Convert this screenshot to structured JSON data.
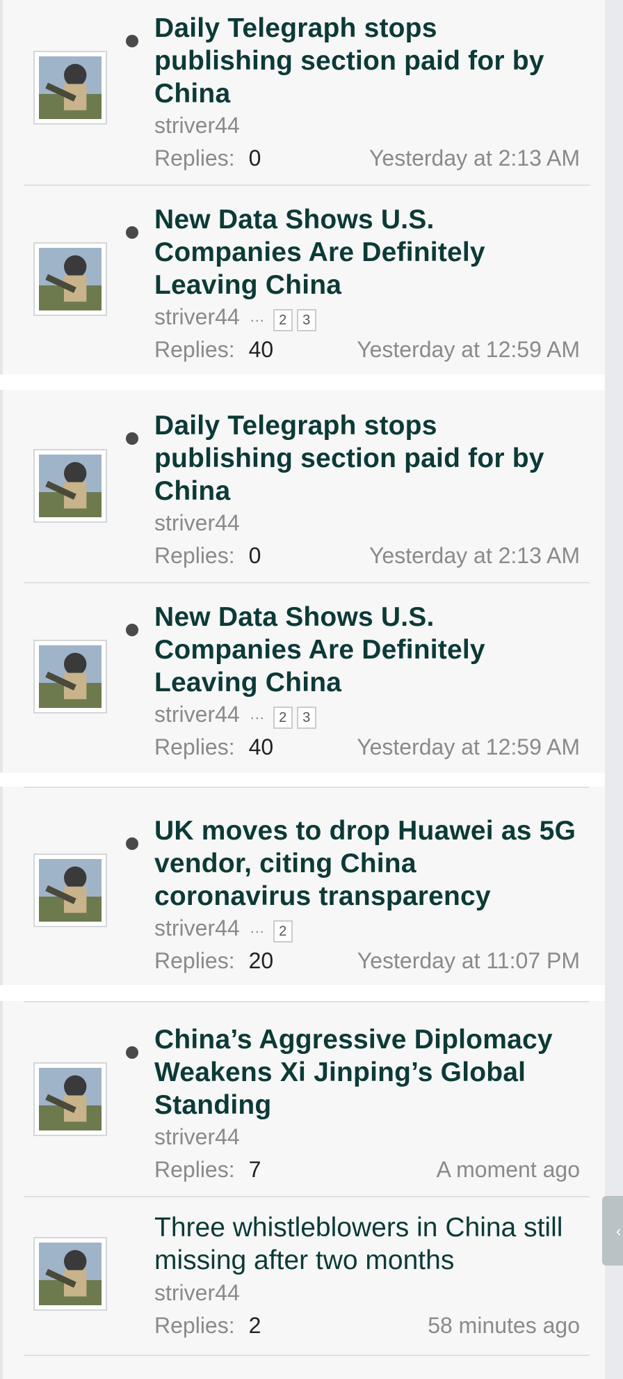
{
  "threads": [
    {
      "title": "Daily Telegraph stops publishing section paid for by China",
      "author": "striver44",
      "pages": [],
      "replies_label": "Replies:",
      "replies": "0",
      "time": "Yesterday at 2:13 AM",
      "unread": true
    },
    {
      "title": "New Data Shows U.S. Companies Are Definitely Leaving China",
      "author": "striver44",
      "pages": [
        "2",
        "3"
      ],
      "replies_label": "Replies:",
      "replies": "40",
      "time": "Yesterday at 12:59 AM",
      "unread": true
    },
    {
      "title": "Daily Telegraph stops publishing section paid for by China",
      "author": "striver44",
      "pages": [],
      "replies_label": "Replies:",
      "replies": "0",
      "time": "Yesterday at 2:13 AM",
      "unread": true
    },
    {
      "title": "New Data Shows U.S. Companies Are Definitely Leaving China",
      "author": "striver44",
      "pages": [
        "2",
        "3"
      ],
      "replies_label": "Replies:",
      "replies": "40",
      "time": "Yesterday at 12:59 AM",
      "unread": true
    },
    {
      "title": "UK moves to drop Huawei as 5G vendor, citing China coronavirus transparency",
      "author": "striver44",
      "pages": [
        "2"
      ],
      "replies_label": "Replies:",
      "replies": "20",
      "time": "Yesterday at 11:07 PM",
      "unread": true
    },
    {
      "title": "China’s Aggressive Diplomacy Weakens Xi Jinping’s Global Standing",
      "author": "striver44",
      "pages": [],
      "replies_label": "Replies:",
      "replies": "7",
      "time": "A moment ago",
      "unread": true
    },
    {
      "title": "Three whistleblowers in China still missing after two months",
      "author": "striver44",
      "pages": [],
      "replies_label": "Replies:",
      "replies": "2",
      "time": "58 minutes ago",
      "unread": false
    }
  ],
  "ellipsis": "…",
  "icons": {
    "avatar": "user-avatar-icon",
    "unread": "unread-dot-icon",
    "side_tab": "chevron-left-icon"
  },
  "colors": {
    "title": "#0c3a36",
    "meta": "#8a8a8a",
    "background": "#f7f7f7"
  }
}
